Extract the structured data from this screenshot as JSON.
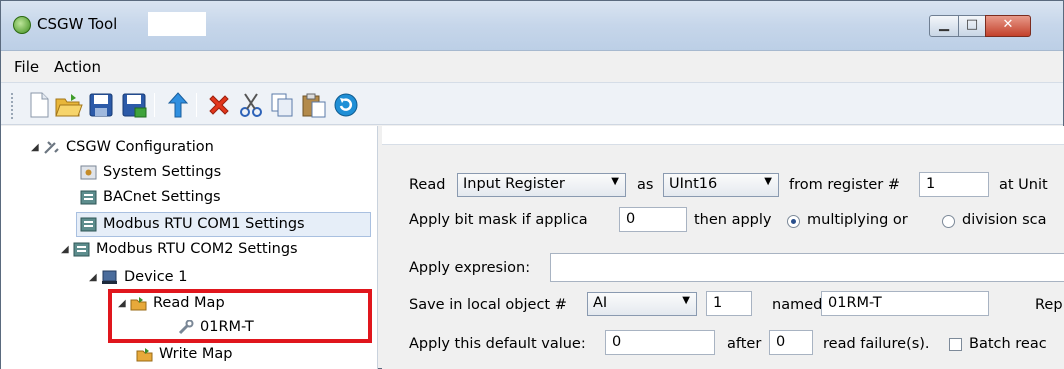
{
  "window": {
    "title": "CSGW Tool",
    "controls": {
      "minimize": "▭",
      "maximize": "▢",
      "close": "✕"
    }
  },
  "menu": {
    "file": "File",
    "action": "Action"
  },
  "toolbar": {
    "buttons": [
      "new-icon",
      "open-icon",
      "save-icon",
      "save-as-icon",
      "upload-icon",
      "delete-icon",
      "cut-icon",
      "copy-icon",
      "paste-icon",
      "refresh-icon"
    ]
  },
  "tree": {
    "root": "CSGW Configuration",
    "system": "System Settings",
    "bacnet": "BACnet Settings",
    "com1": "Modbus RTU COM1 Settings",
    "com2": "Modbus RTU COM2 Settings",
    "device": "Device 1",
    "read_map": "Read Map",
    "read_item": "01RM-T",
    "write_map": "Write Map"
  },
  "form": {
    "read_label": "Read",
    "register_type": "Input Register",
    "as_label": "as",
    "data_type": "UInt16",
    "from_register_label": "from register #",
    "register_number": "1",
    "at_unit_label": "at Unit",
    "mask_label": "Apply bit mask if applica",
    "mask_value": "0",
    "then_apply_label": "then apply",
    "multiply_label": "multiplying or",
    "division_label": "division sca",
    "expression_label": "Apply expresion:",
    "expression_value": "",
    "save_label": "Save in local object #",
    "object_type": "AI",
    "object_number": "1",
    "named_label": "named",
    "object_name": "01RM-T",
    "rep_label": "Rep",
    "default_label": "Apply this default value:",
    "default_value": "0",
    "after_label": "after",
    "failures_value": "0",
    "failures_label": "read failure(s).",
    "batch_label": "Batch reac"
  }
}
